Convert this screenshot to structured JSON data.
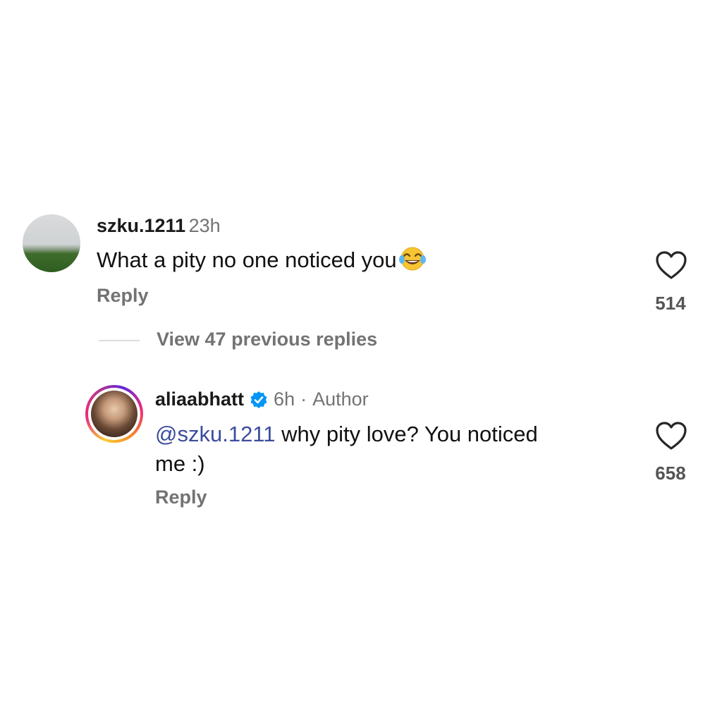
{
  "comment": {
    "username": "szku.1211",
    "time": "23h",
    "text": "What a pity no one noticed you",
    "emoji_icon": "face-with-tears-of-joy-icon",
    "reply_label": "Reply",
    "like_count": "514"
  },
  "view_previous": "View 47 previous replies",
  "reply": {
    "username": "aliaabhatt",
    "verified_icon": "verified-badge-icon",
    "time": "6h",
    "separator": "·",
    "author_label": "Author",
    "mention": "@szku.1211",
    "text_line1": "why pity love? You noticed",
    "text_line2": "me :)",
    "reply_label": "Reply",
    "like_count": "658"
  },
  "colors": {
    "mention": "#3c4d9c",
    "verified": "#0095f6",
    "muted": "#737373"
  }
}
